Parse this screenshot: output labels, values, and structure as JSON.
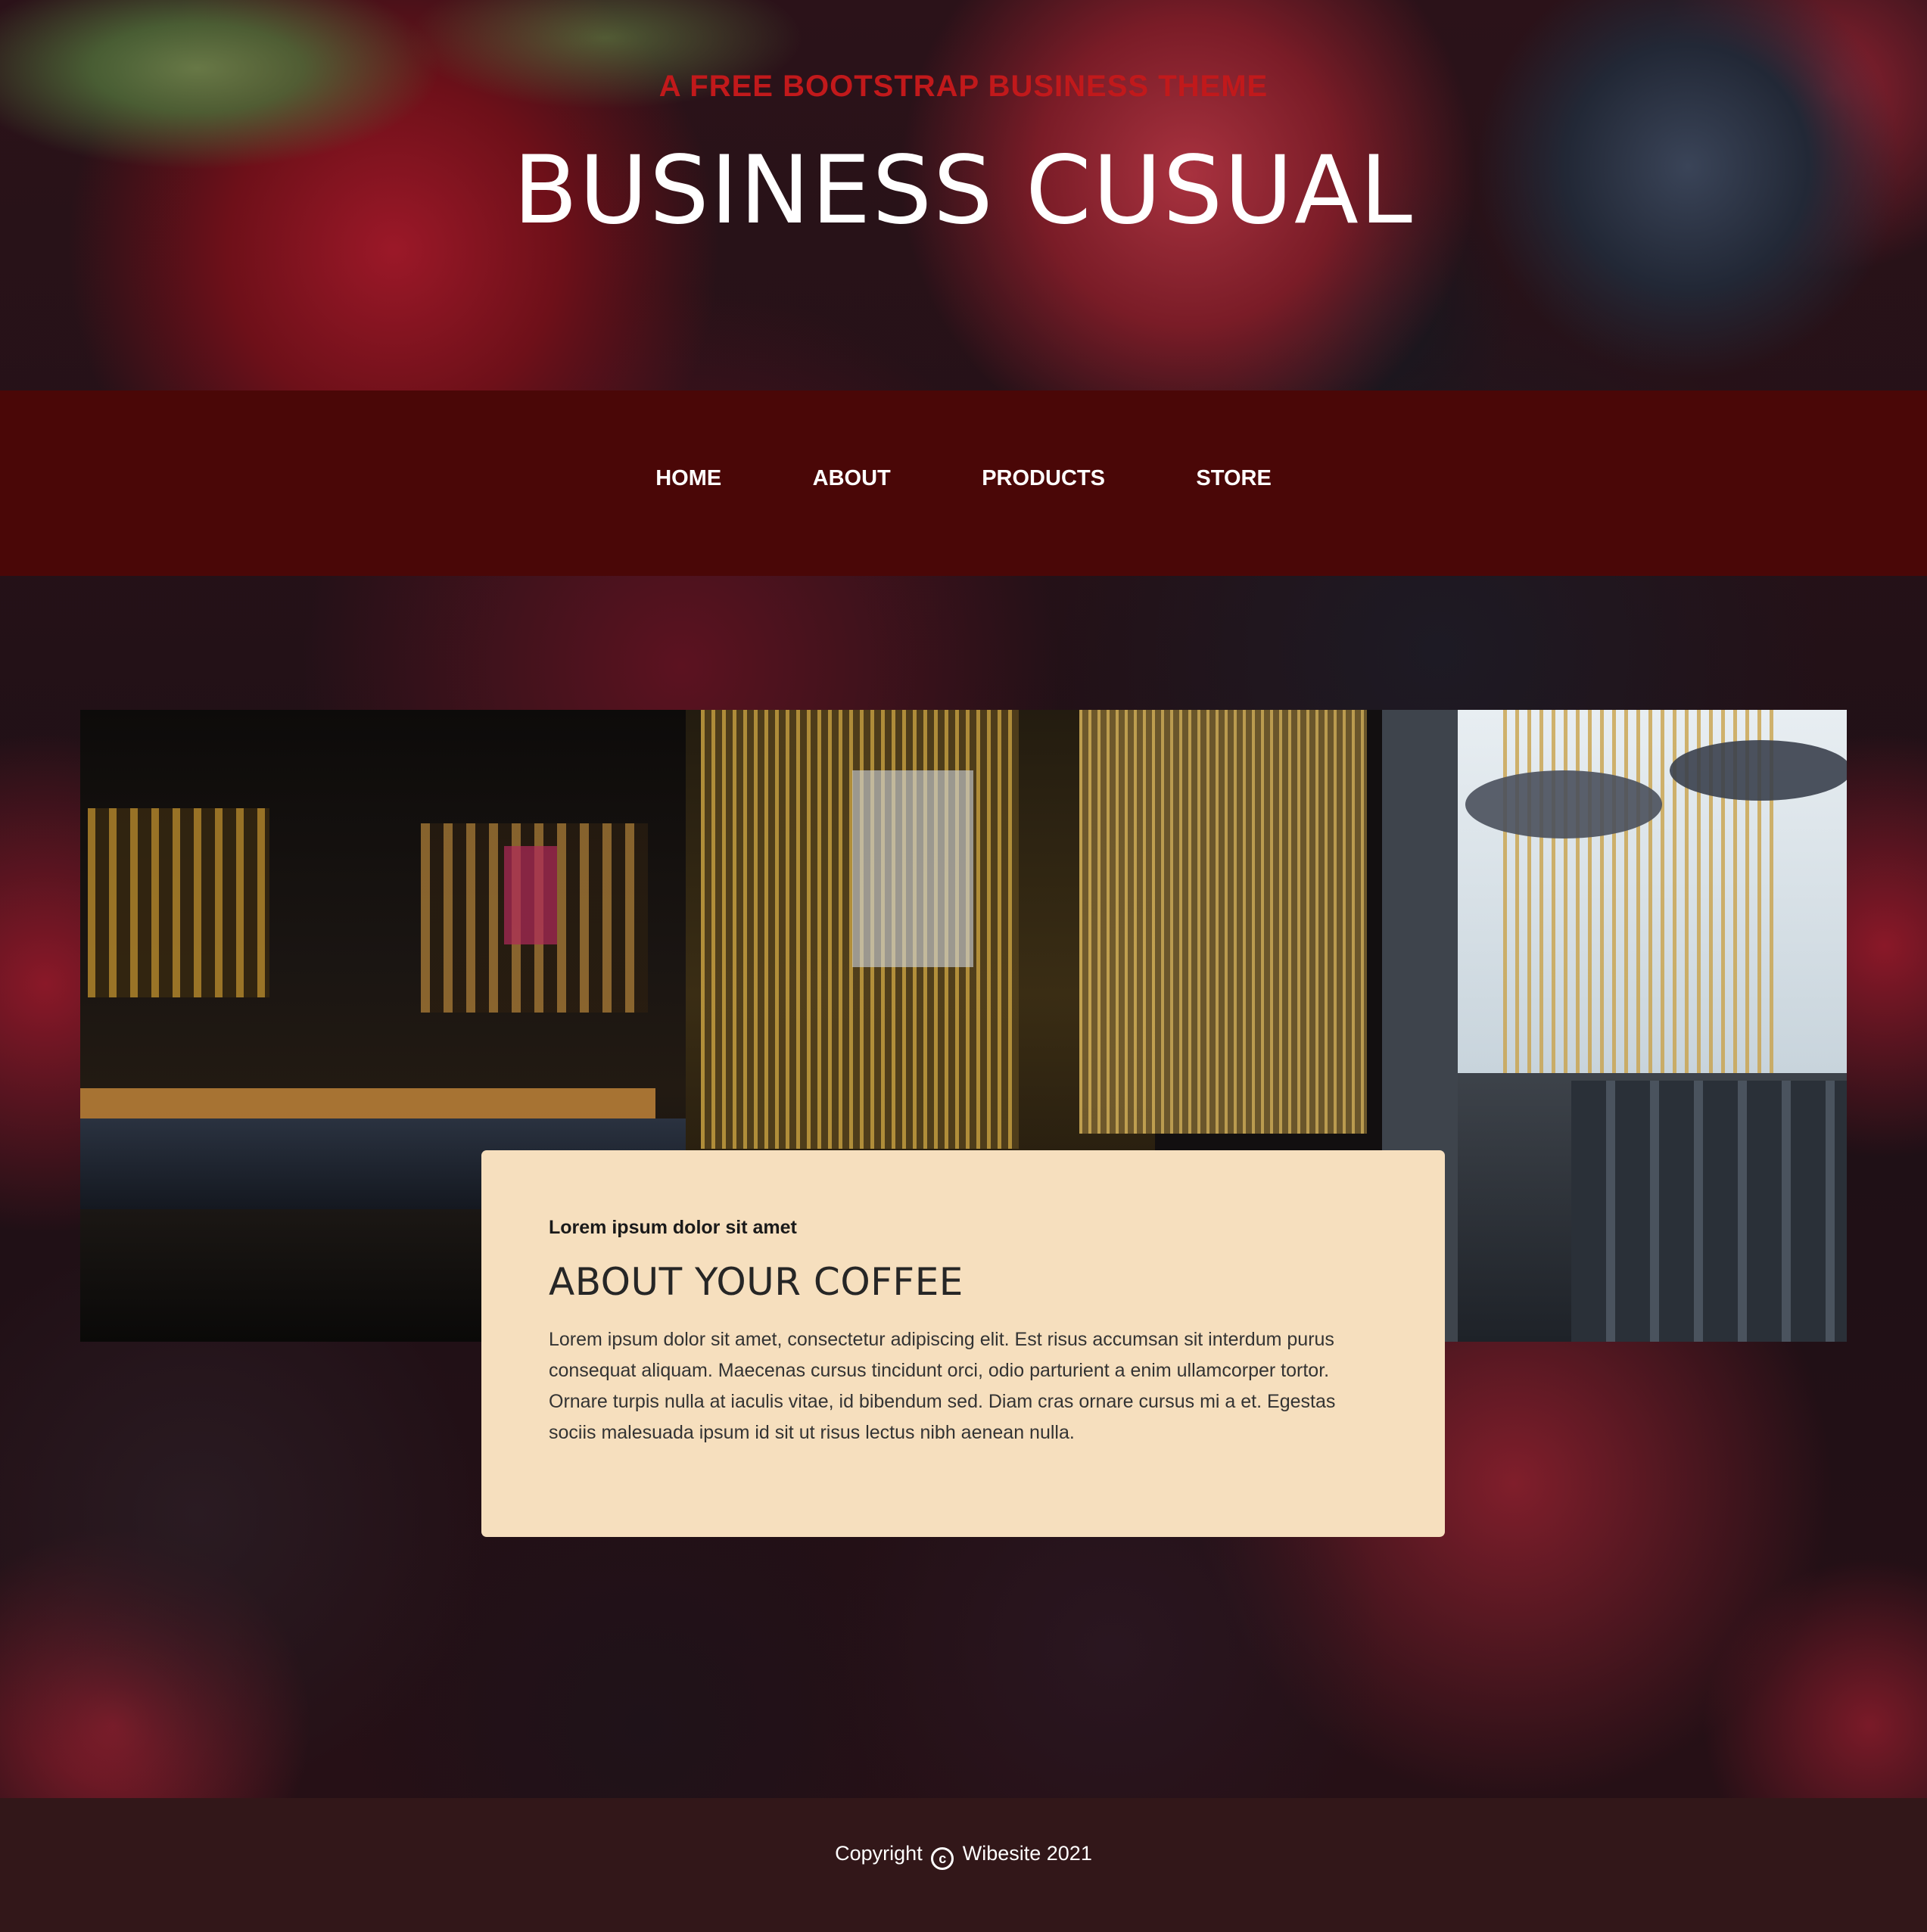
{
  "header": {
    "tagline": "A FREE BOOTSTRAP BUSINESS THEME",
    "brand": "BUSINESS CUSUAL"
  },
  "nav": {
    "items": [
      {
        "label": "HOME"
      },
      {
        "label": "ABOUT"
      },
      {
        "label": "PRODUCTS"
      },
      {
        "label": "STORE"
      }
    ]
  },
  "about": {
    "eyebrow": "Lorem ipsum dolor sit amet",
    "heading": "ABOUT YOUR COFFEE",
    "body": "Lorem ipsum dolor sit amet, consectetur adipiscing elit. Est risus accumsan sit interdum purus consequat aliquam. Maecenas cursus tincidunt orci, odio parturient a enim ullamcorper tortor. Ornare turpis nulla at iaculis vitae, id bibendum sed. Diam cras ornare cursus mi a et. Egestas sociis malesuada ipsum id sit ut risus lectus nibh aenean nulla."
  },
  "footer": {
    "copyright_prefix": "Copyright",
    "copyright_symbol": "c",
    "copyright_suffix": "Wibesite 2021"
  },
  "colors": {
    "tagline": "#c1191b",
    "navbar": "#4a0707",
    "card": "#f6dfbe",
    "footer": "#321719"
  }
}
